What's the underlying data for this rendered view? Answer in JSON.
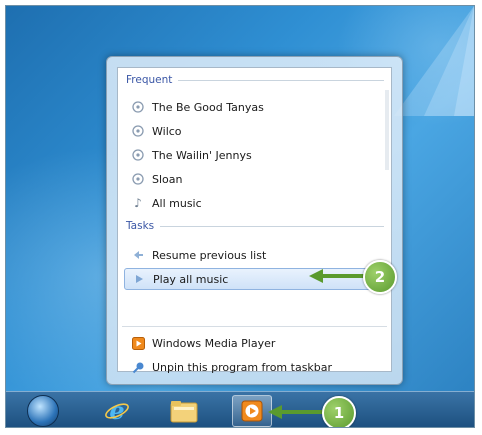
{
  "jumplist": {
    "frequent_header": "Frequent",
    "frequent_items": [
      {
        "label": "The Be Good Tanyas",
        "icon": "album-icon"
      },
      {
        "label": "Wilco",
        "icon": "album-icon"
      },
      {
        "label": "The Wailin' Jennys",
        "icon": "album-icon"
      },
      {
        "label": "Sloan",
        "icon": "album-icon"
      },
      {
        "label": "All music",
        "icon": "music-note-icon"
      }
    ],
    "tasks_header": "Tasks",
    "task_items": [
      {
        "label": "Resume previous list",
        "icon": "resume-icon"
      },
      {
        "label": "Play all music",
        "icon": "play-icon",
        "highlighted": true
      }
    ],
    "program_items": [
      {
        "label": "Windows Media Player",
        "icon": "windows-media-player-icon"
      },
      {
        "label": "Unpin this program from taskbar",
        "icon": "unpin-icon"
      }
    ]
  },
  "callouts": {
    "step1": "1",
    "step2": "2",
    "color": "#6aae3a"
  },
  "taskbar": {
    "items": [
      "start-button",
      "internet-explorer-icon",
      "windows-explorer-icon",
      "windows-media-player-icon"
    ]
  }
}
